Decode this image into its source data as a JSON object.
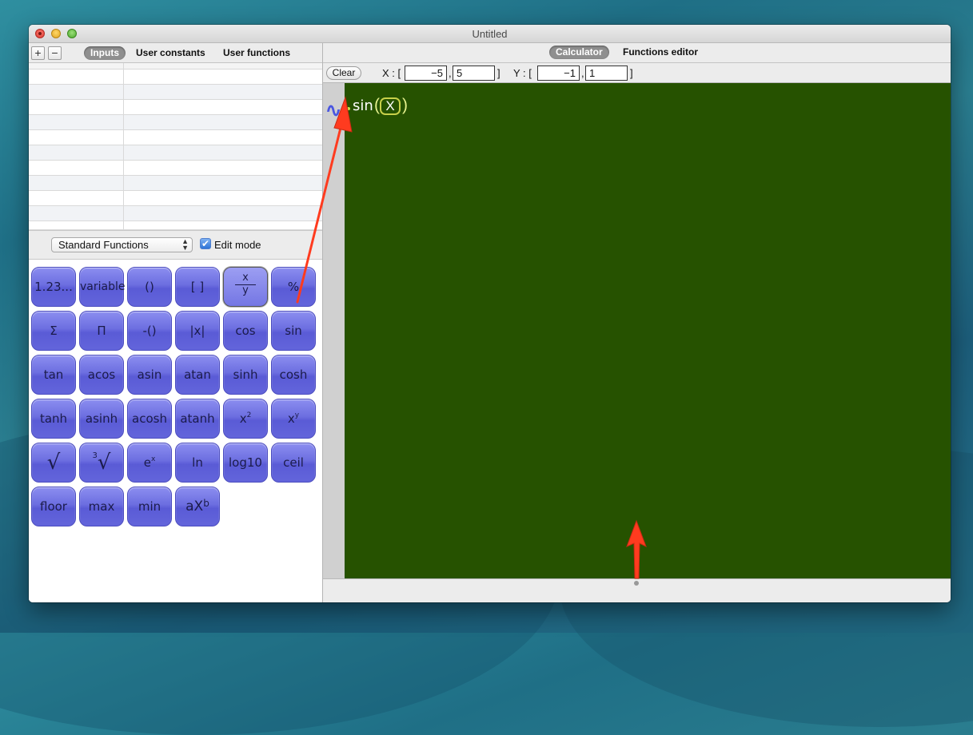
{
  "window": {
    "title": "Untitled"
  },
  "left": {
    "add_button": "+",
    "remove_button": "−",
    "tabs": [
      "Inputs",
      "User constants",
      "User functions"
    ],
    "function_set": "Standard Functions",
    "edit_mode_label": "Edit mode",
    "edit_mode_checked": true
  },
  "keypad": {
    "row1": [
      "1.23...",
      "variable",
      "()",
      "[ ]",
      "x/y",
      "%"
    ],
    "fraction_top": "x",
    "fraction_bottom": "y",
    "row2": [
      "Σ",
      "Π",
      "-()",
      "|x|",
      "cos",
      "sin"
    ],
    "row3": [
      "tan",
      "acos",
      "asin",
      "atan",
      "sinh",
      "cosh"
    ],
    "row4": [
      "tanh",
      "asinh",
      "acosh",
      "atanh",
      "x",
      "x"
    ],
    "row4_sup": [
      "2",
      "y"
    ],
    "row5": [
      "√",
      "√",
      "e",
      "ln",
      "log10",
      "ceil"
    ],
    "cube_root_index": "3",
    "exp_sup": "x",
    "row6": [
      "floor",
      "max",
      "min",
      "aX"
    ],
    "power_sup": "b"
  },
  "right": {
    "tabs": [
      "Calculator",
      "Functions editor"
    ],
    "clear_button": "Clear",
    "x_label": "X : [",
    "x_min": "−5",
    "x_sep": ",",
    "x_max": "5",
    "x_close": "]",
    "y_label": "Y : [",
    "y_min": "−1",
    "y_sep": ",",
    "y_max": "1",
    "y_close": "]"
  },
  "graph": {
    "function_name": "sin",
    "variable": "X",
    "open_paren": "(",
    "close_paren": ")",
    "background": "#265200",
    "curve_icon": "∿"
  },
  "colors": {
    "key_fill": "#6c6ee0",
    "annotation_arrow": "#ff3b1f"
  }
}
